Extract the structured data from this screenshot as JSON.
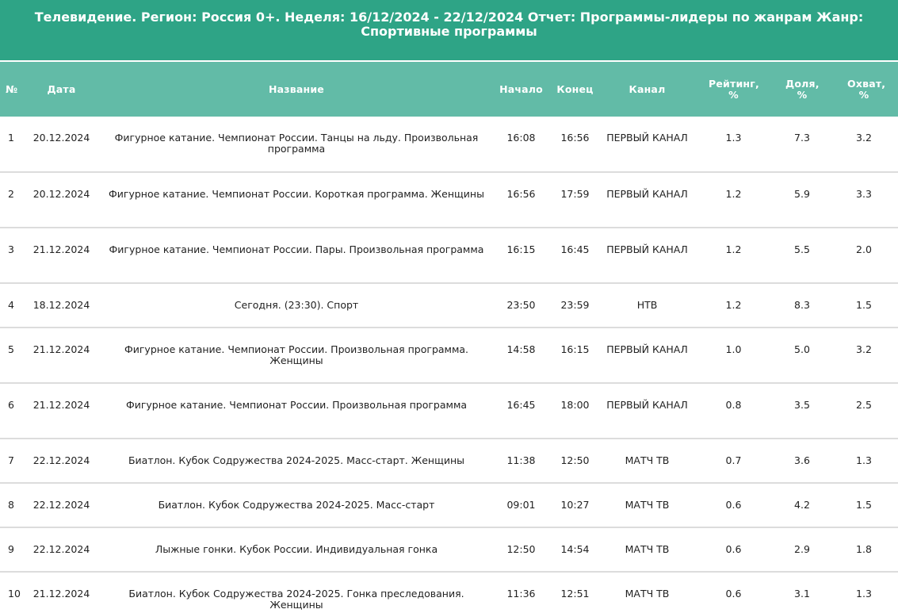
{
  "title": "Телевидение. Регион: Россия 0+. Неделя: 16/12/2024 - 22/12/2024 Отчет: Программы-лидеры по жанрам Жанр: Спортивные программы",
  "colors": {
    "header_bg": "#2ea486",
    "table_header_bg": "#62bba7",
    "row_border": "#dcdcdc"
  },
  "columns": {
    "num": "№",
    "date": "Дата",
    "name": "Название",
    "start": "Начало",
    "end": "Конец",
    "channel": "Канал",
    "rating": "Рейтинг, %",
    "share": "Доля, %",
    "reach": "Охват, %"
  },
  "rows": [
    {
      "num": "1",
      "date": "20.12.2024",
      "name": "Фигурное катание. Чемпионат России. Танцы на льду. Произвольная программа",
      "start": "16:08",
      "end": "16:56",
      "channel": "ПЕРВЫЙ КАНАЛ",
      "rating": "1.3",
      "share": "7.3",
      "reach": "3.2"
    },
    {
      "num": "2",
      "date": "20.12.2024",
      "name": "Фигурное катание. Чемпионат России. Короткая программа. Женщины",
      "start": "16:56",
      "end": "17:59",
      "channel": "ПЕРВЫЙ КАНАЛ",
      "rating": "1.2",
      "share": "5.9",
      "reach": "3.3"
    },
    {
      "num": "3",
      "date": "21.12.2024",
      "name": "Фигурное катание. Чемпионат России. Пары. Произвольная программа",
      "start": "16:15",
      "end": "16:45",
      "channel": "ПЕРВЫЙ КАНАЛ",
      "rating": "1.2",
      "share": "5.5",
      "reach": "2.0"
    },
    {
      "num": "4",
      "date": "18.12.2024",
      "name": "Сегодня. (23:30). Спорт",
      "start": "23:50",
      "end": "23:59",
      "channel": "НТВ",
      "rating": "1.2",
      "share": "8.3",
      "reach": "1.5"
    },
    {
      "num": "5",
      "date": "21.12.2024",
      "name": "Фигурное катание. Чемпионат России. Произвольная программа. Женщины",
      "start": "14:58",
      "end": "16:15",
      "channel": "ПЕРВЫЙ КАНАЛ",
      "rating": "1.0",
      "share": "5.0",
      "reach": "3.2"
    },
    {
      "num": "6",
      "date": "21.12.2024",
      "name": "Фигурное катание. Чемпионат России. Произвольная программа",
      "start": "16:45",
      "end": "18:00",
      "channel": "ПЕРВЫЙ КАНАЛ",
      "rating": "0.8",
      "share": "3.5",
      "reach": "2.5"
    },
    {
      "num": "7",
      "date": "22.12.2024",
      "name": "Биатлон. Кубок Содружества 2024-2025. Масс-старт. Женщины",
      "start": "11:38",
      "end": "12:50",
      "channel": "МАТЧ ТВ",
      "rating": "0.7",
      "share": "3.6",
      "reach": "1.3"
    },
    {
      "num": "8",
      "date": "22.12.2024",
      "name": "Биатлон. Кубок Содружества 2024-2025. Масс-старт",
      "start": "09:01",
      "end": "10:27",
      "channel": "МАТЧ ТВ",
      "rating": "0.6",
      "share": "4.2",
      "reach": "1.5"
    },
    {
      "num": "9",
      "date": "22.12.2024",
      "name": "Лыжные гонки. Кубок России. Индивидуальная гонка",
      "start": "12:50",
      "end": "14:54",
      "channel": "МАТЧ ТВ",
      "rating": "0.6",
      "share": "2.9",
      "reach": "1.8"
    },
    {
      "num": "10",
      "date": "21.12.2024",
      "name": "Биатлон. Кубок Содружества 2024-2025. Гонка преследования. Женщины",
      "start": "11:36",
      "end": "12:51",
      "channel": "МАТЧ ТВ",
      "rating": "0.6",
      "share": "3.1",
      "reach": "1.3"
    }
  ]
}
